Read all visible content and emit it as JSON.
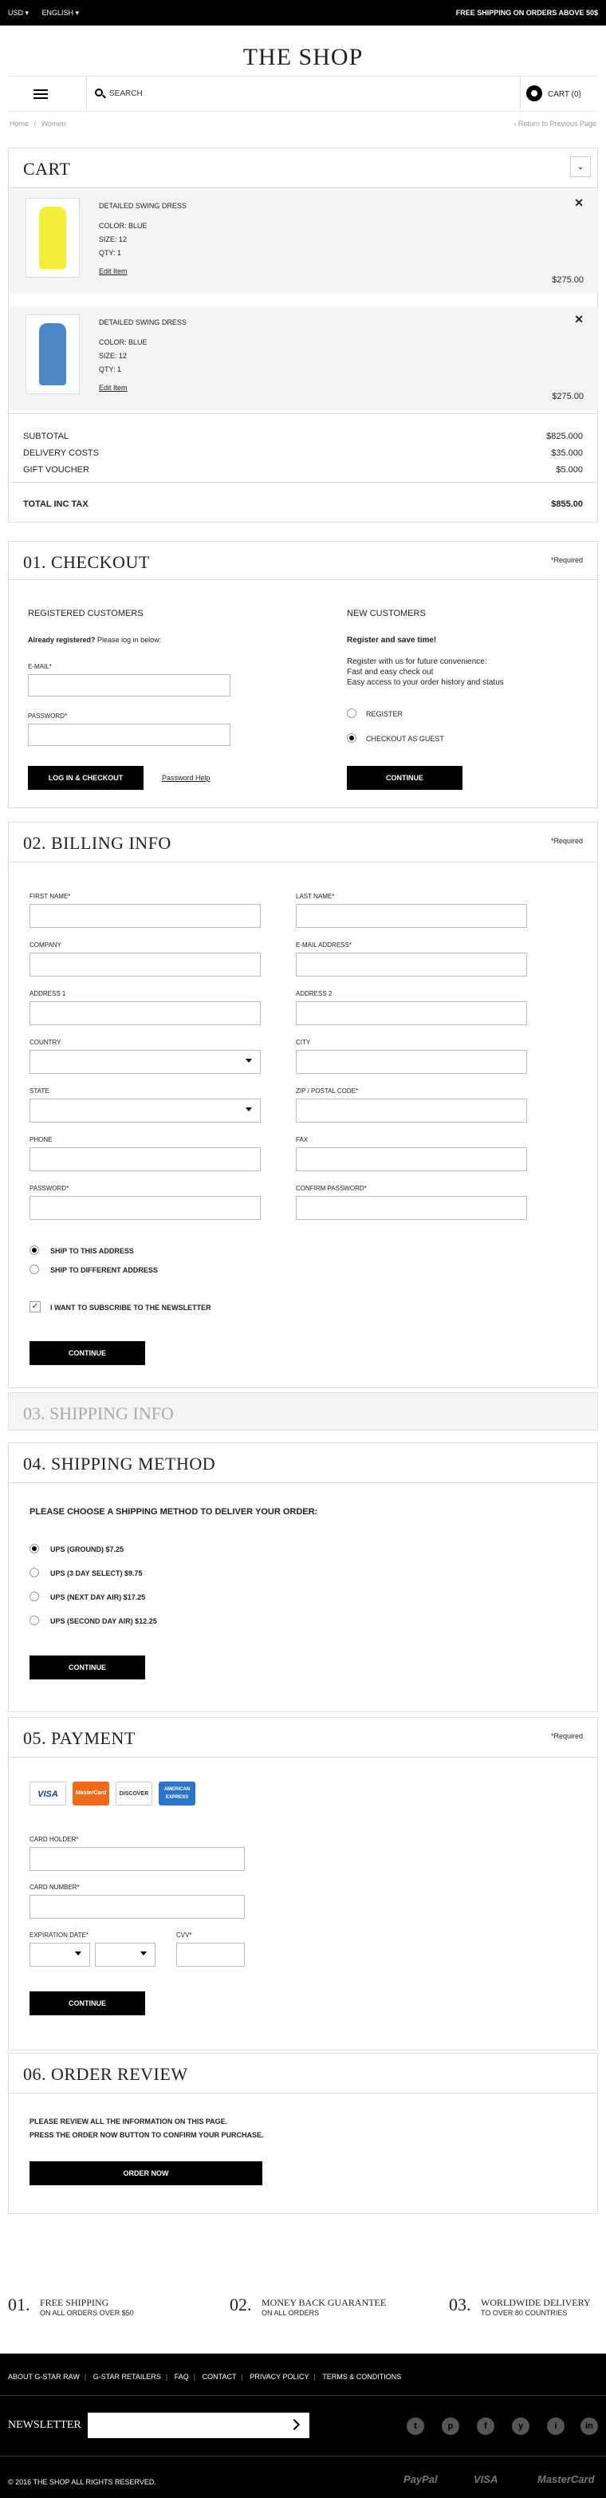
{
  "topbar": {
    "currency": "USD ▾",
    "language": "ENGLISH ▾",
    "promo": "FREE SHIPPING ON ORDERS ABOVE 50$"
  },
  "header": {
    "logo": "THE SHOP",
    "search_placeholder": "SEARCH",
    "cart_label": "CART (0)"
  },
  "breadcrumb": {
    "home": "Home",
    "sep": "/",
    "current": "Women",
    "back": "‹ Return to Previous Page"
  },
  "cart": {
    "title": "CART",
    "items": [
      {
        "name": "DETAILED SWING DRESS",
        "color": "COLOR: BLUE",
        "size": "SIZE: 12",
        "qty": "QTY: 1",
        "edit": "Edit Item",
        "price": "$275.00",
        "close": "✕",
        "thumb_color": "#f2ee3b"
      },
      {
        "name": "DETAILED SWING DRESS",
        "color": "COLOR: BLUE",
        "size": "SIZE: 12",
        "qty": "QTY: 1",
        "edit": "Edit Item",
        "price": "$275.00",
        "close": "✕",
        "thumb_color": "#4d88c4"
      }
    ],
    "totals": [
      {
        "label": "SUBTOTAL",
        "value": "$825.000"
      },
      {
        "label": "DELIVERY COSTS",
        "value": "$35.000"
      },
      {
        "label": "GIFT VOUCHER",
        "value": "$5.000"
      }
    ],
    "grand_label": "TOTAL INC TAX",
    "grand_value": "$855.00"
  },
  "checkout": {
    "title": "01. CHECKOUT",
    "required": "*Required",
    "registered_title": "REGISTERED CUSTOMERS",
    "already_bold": "Already registered?",
    "already_rest": " Please log in below:",
    "email_label": "E-MAIL*",
    "password_label": "PASSWORD*",
    "login_button": "LOG IN & CHECKOUT",
    "password_help": "Password Help",
    "new_title": "NEW CUSTOMERS",
    "new_bold": "Register and save time!",
    "new_line1": "Register with us for future convenience:",
    "new_line2": "Fast and easy check out",
    "new_line3": "Easy access to your order history and status",
    "opt_register": "REGISTER",
    "opt_guest": "CHECKOUT AS GUEST",
    "continue": "CONTINUE"
  },
  "billing": {
    "title": "02. BILLING INFO",
    "required": "*Required",
    "first_name": "FIRST NAME*",
    "last_name": "LAST NAME*",
    "company": "COMPANY",
    "email": "E-MAIL ADDRESS*",
    "address1": "ADDRESS 1",
    "address2": "ADDRESS 2",
    "country": "COUNTRY",
    "city": "CITY",
    "state": "STATE",
    "zip": "ZIP / POSTAL CODE*",
    "phone": "PHONE",
    "fax": "FAX",
    "password": "PASSWORD*",
    "confirm_password": "CONFIRM PASSWORD*",
    "ship_this": "SHIP TO THIS ADDRESS",
    "ship_diff": "SHIP TO DIFFERENT ADDRESS",
    "newsletter": "I WANT TO SUBSCRIBE TO THE NEWSLETTER",
    "check_mark": "✓",
    "continue": "CONTINUE"
  },
  "shipping_info": {
    "title": "03. SHIPPING INFO"
  },
  "shipping_method": {
    "title": "04. SHIPPING METHOD",
    "prompt": "PLEASE CHOOSE A SHIPPING METHOD TO DELIVER YOUR ORDER:",
    "options": [
      "UPS (GROUND) $7.25",
      "UPS (3 DAY SELECT) $9.75",
      "UPS (NEXT DAY AIR) $17.25",
      "UPS (SECOND DAY AIR) $12.25"
    ],
    "continue": "CONTINUE"
  },
  "payment": {
    "title": "05. PAYMENT",
    "required": "*Required",
    "cards": [
      "VISA",
      "MasterCard",
      "DISCOVER",
      "AMERICAN EXPRESS"
    ],
    "card_holder": "CARD HOLDER*",
    "card_number": "CARD NUMBER*",
    "expiration": "EXPIRATION DATE*",
    "cvv": "CVV*",
    "continue": "CONTINUE"
  },
  "review": {
    "title": "06. ORDER REVIEW",
    "line1": "PLEASE REVIEW ALL THE INFORMATION ON THIS PAGE.",
    "line2": "PRESS THE ORDER NOW BUTTON TO CONFIRM YOUR PURCHASE.",
    "button": "ORDER NOW"
  },
  "features": [
    {
      "num": "01.",
      "title": "FREE SHIPPING",
      "sub": "ON ALL ORDERS OVER $50"
    },
    {
      "num": "02.",
      "title": "MONEY BACK GUARANTEE",
      "sub": "ON ALL ORDERS"
    },
    {
      "num": "03.",
      "title": "WORLDWIDE DELIVERY",
      "sub": "TO OVER 80 COUNTRIES"
    }
  ],
  "footer": {
    "links": [
      "ABOUT G-STAR RAW",
      "G-STAR RETAILERS",
      "FAQ",
      "CONTACT",
      "PRIVACY POLICY",
      "TERMS & CONDITIONS"
    ],
    "link_sep": "|",
    "newsletter": "NEWSLETTER",
    "social": [
      "t",
      "p",
      "f",
      "y",
      "i",
      "in"
    ],
    "copyright": "© 2016 THE SHOP ALL RIGHTS RESERVED.",
    "payments": [
      "PayPal",
      "VISA",
      "MasterCard"
    ]
  }
}
